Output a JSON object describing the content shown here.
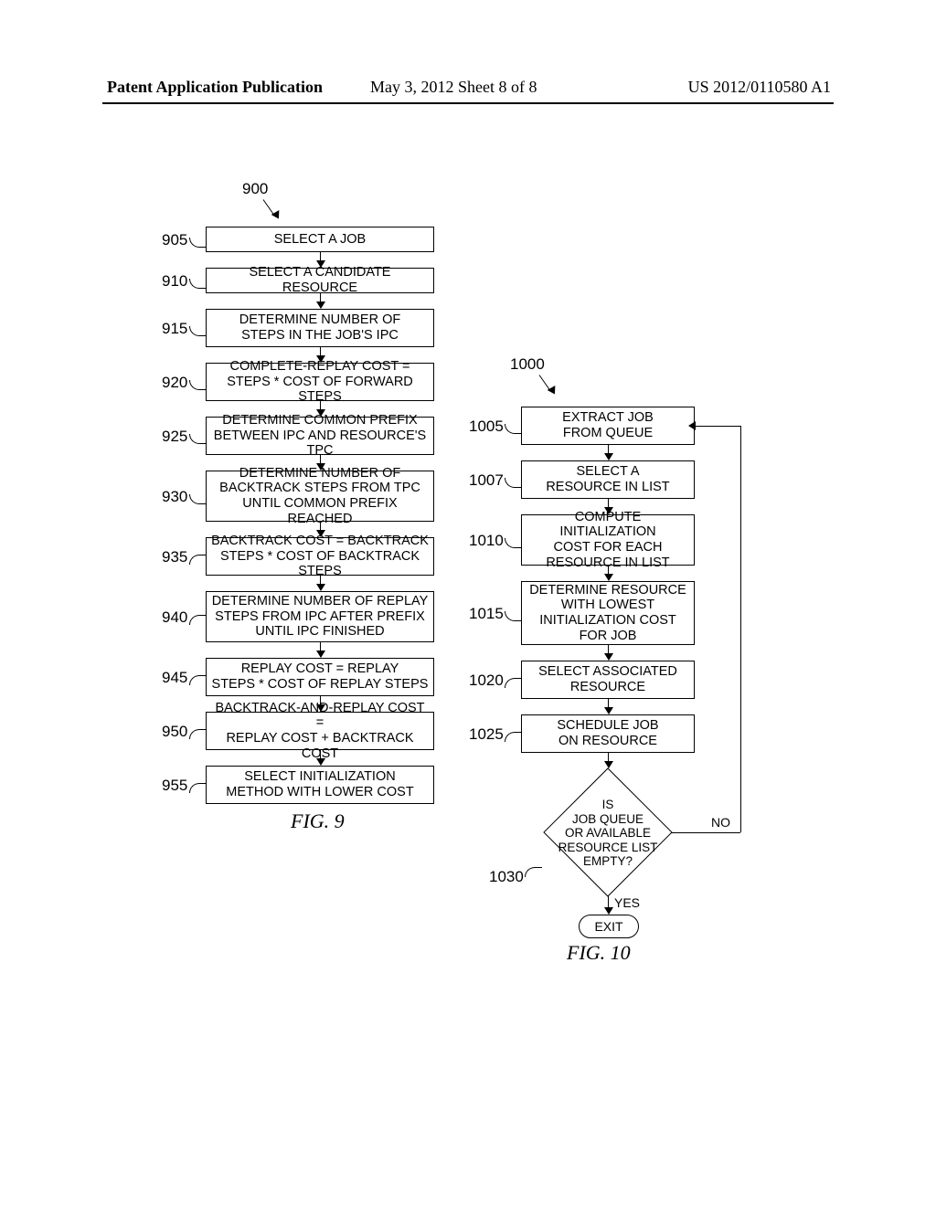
{
  "header": {
    "left": "Patent Application Publication",
    "mid": "May 3, 2012   Sheet 8 of 8",
    "right": "US 2012/0110580 A1"
  },
  "fig9": {
    "start_ref": "900",
    "caption": "FIG. 9",
    "steps": [
      {
        "ref": "905",
        "text": "SELECT A JOB"
      },
      {
        "ref": "910",
        "text": "SELECT A CANDIDATE RESOURCE"
      },
      {
        "ref": "915",
        "text": "DETERMINE NUMBER OF\nSTEPS IN THE JOB'S IPC"
      },
      {
        "ref": "920",
        "text": "COMPLETE-REPLAY COST =\nSTEPS * COST OF FORWARD STEPS"
      },
      {
        "ref": "925",
        "text": "DETERMINE COMMON PREFIX\nBETWEEN IPC AND RESOURCE'S TPC"
      },
      {
        "ref": "930",
        "text": "DETERMINE NUMBER OF\nBACKTRACK STEPS FROM TPC\nUNTIL COMMON PREFIX REACHED"
      },
      {
        "ref": "935",
        "text": "BACKTRACK COST = BACKTRACK\nSTEPS * COST OF BACKTRACK STEPS"
      },
      {
        "ref": "940",
        "text": "DETERMINE NUMBER OF REPLAY\nSTEPS FROM IPC AFTER PREFIX\nUNTIL IPC FINISHED"
      },
      {
        "ref": "945",
        "text": "REPLAY COST = REPLAY\nSTEPS * COST OF REPLAY STEPS"
      },
      {
        "ref": "950",
        "text": "BACKTRACK-AND-REPLAY COST =\nREPLAY COST + BACKTRACK COST"
      },
      {
        "ref": "955",
        "text": "SELECT INITIALIZATION\nMETHOD WITH LOWER COST"
      }
    ]
  },
  "fig10": {
    "start_ref": "1000",
    "caption": "FIG. 10",
    "steps": [
      {
        "ref": "1005",
        "text": "EXTRACT JOB\nFROM QUEUE"
      },
      {
        "ref": "1007",
        "text": "SELECT A\nRESOURCE IN LIST"
      },
      {
        "ref": "1010",
        "text": "COMPUTE INITIALIZATION\nCOST FOR EACH\nRESOURCE IN LIST"
      },
      {
        "ref": "1015",
        "text": "DETERMINE RESOURCE\nWITH LOWEST\nINITIALIZATION COST\nFOR JOB"
      },
      {
        "ref": "1020",
        "text": "SELECT ASSOCIATED\nRESOURCE"
      },
      {
        "ref": "1025",
        "text": "SCHEDULE JOB\nON RESOURCE"
      }
    ],
    "decision": {
      "ref": "1030",
      "text": "IS\nJOB QUEUE\nOR AVAILABLE\nRESOURCE LIST\nEMPTY?",
      "yes": "YES",
      "no": "NO"
    },
    "exit": "EXIT"
  }
}
